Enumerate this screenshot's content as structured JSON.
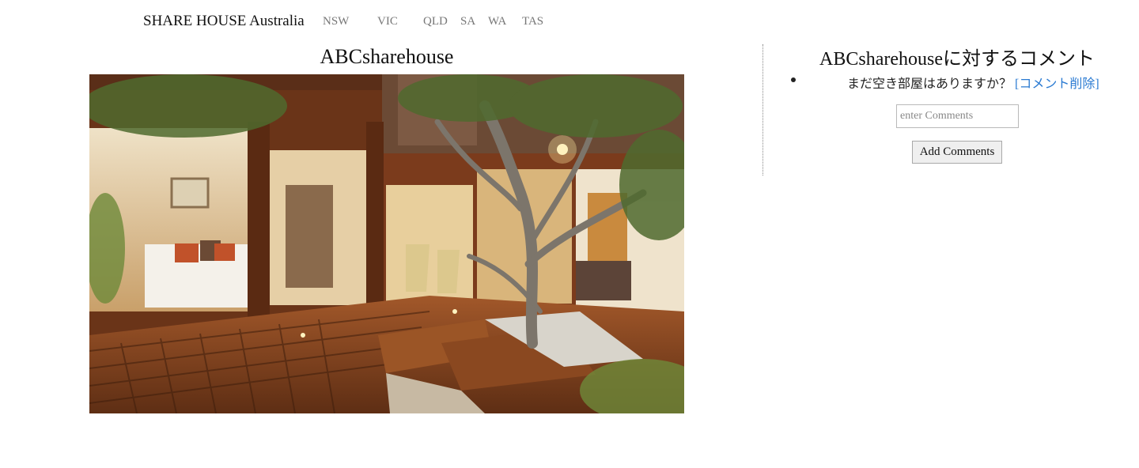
{
  "nav": {
    "brand": "SHARE HOUSE Australia",
    "links": [
      "NSW",
      "VIC",
      "QLD",
      "SA",
      "WA",
      "TAS"
    ]
  },
  "listing": {
    "title": "ABCsharehouse"
  },
  "comments": {
    "title": "ABCsharehouseに対するコメント",
    "items": [
      {
        "text": "まだ空き部屋はありますか？",
        "delete_label": "[コメント削除]"
      }
    ],
    "input_placeholder": "enter Comments",
    "add_button_label": "Add Comments"
  },
  "colors": {
    "link": "#2a7ad2",
    "nav_link": "#777777"
  }
}
